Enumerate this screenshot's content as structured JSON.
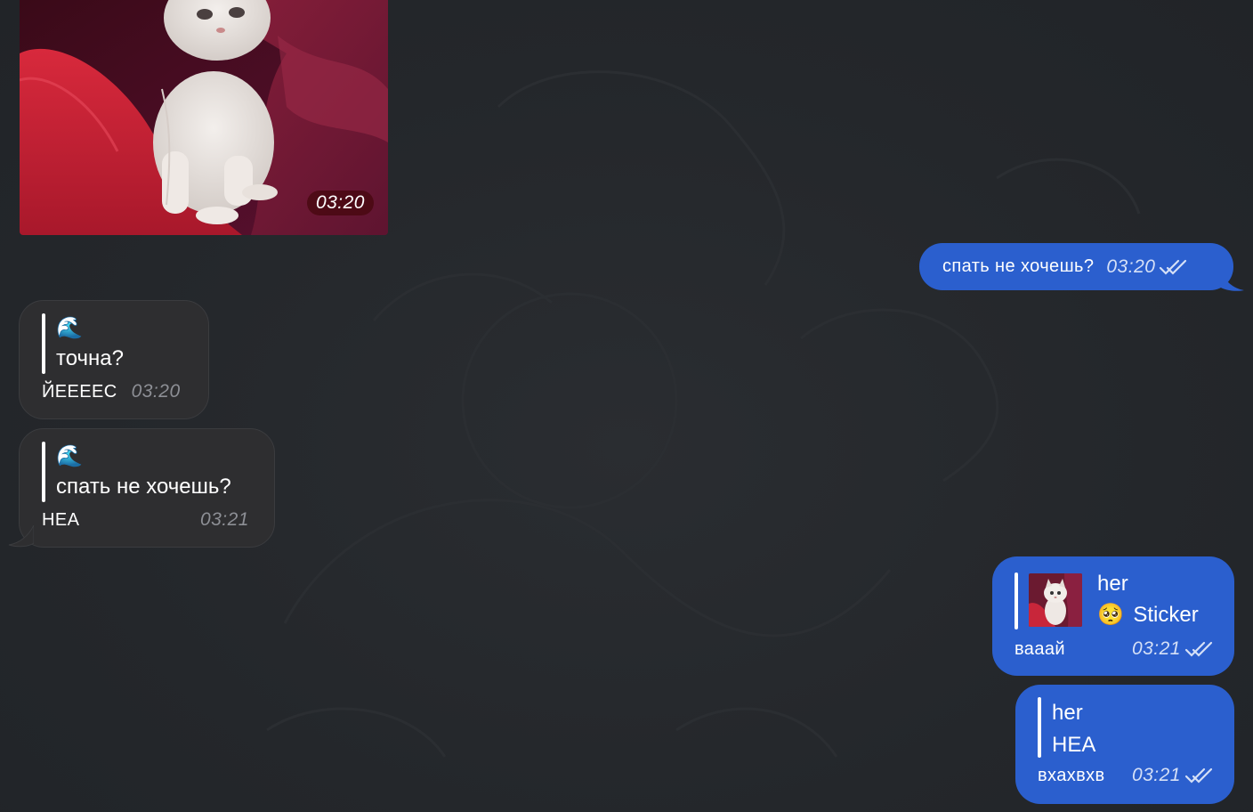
{
  "colors": {
    "background": "#24272b",
    "incoming_bubble": "#2e2e30",
    "outgoing_bubble": "#2b5fce"
  },
  "messages": [
    {
      "type": "photo",
      "direction": "incoming",
      "time": "03:20"
    },
    {
      "type": "text",
      "direction": "outgoing",
      "text": "спать не хочешь?",
      "time": "03:20",
      "status_icon": "double-check-icon"
    },
    {
      "type": "reply",
      "direction": "incoming",
      "quote_title": "🌊",
      "quote_text": "точна?",
      "text": "ЙЕЕЕЕС",
      "time": "03:20"
    },
    {
      "type": "reply",
      "direction": "incoming",
      "quote_title": "🌊",
      "quote_text": "спать не хочешь?",
      "text": "НЕА",
      "time": "03:21"
    },
    {
      "type": "reply",
      "direction": "outgoing",
      "quote_title": "her",
      "quote_emoji": "🥺",
      "quote_text": "Sticker",
      "text": "вааай",
      "time": "03:21",
      "status_icon": "double-check-icon"
    },
    {
      "type": "reply",
      "direction": "outgoing",
      "quote_title": "her",
      "quote_text": "НЕА",
      "text": "вхахвхв",
      "time": "03:21",
      "status_icon": "double-check-icon"
    }
  ]
}
